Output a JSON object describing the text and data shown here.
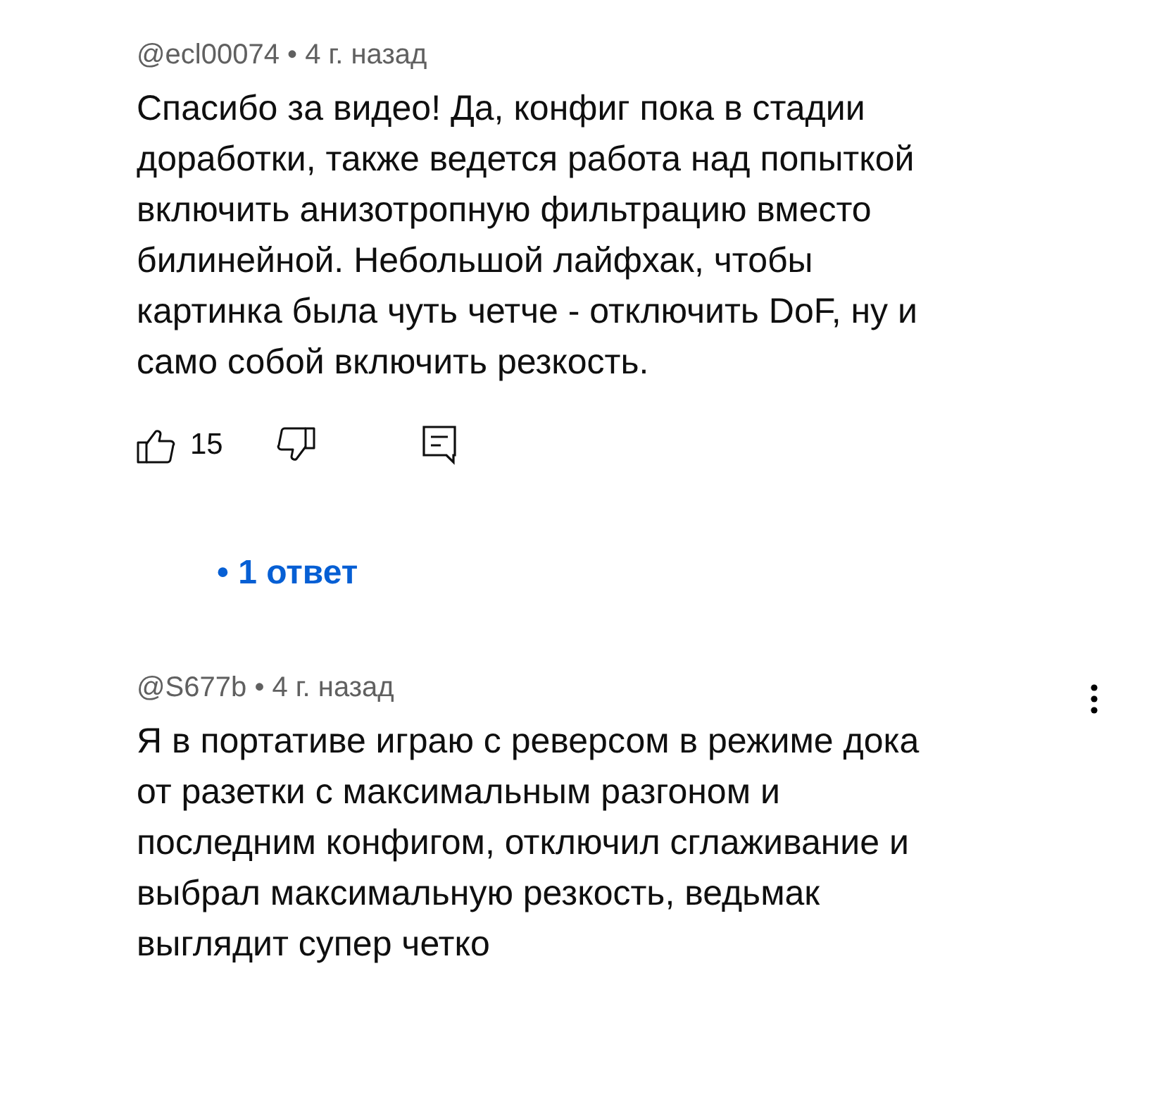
{
  "comments": [
    {
      "meta": "@ecl00074 • 4 г. назад",
      "menu": false,
      "text": "Спасибо за видео! Да, конфиг пока в стадии\nдоработки, также ведется работа над попыткой\nвключить анизотропную фильтрацию вместо\nбилинейной. Небольшой лайфхак, чтобы\nкартинка была чуть четче - отключить DoF, ну и\nсамо собой включить резкость.",
      "likes": "15",
      "replies": "• 1 ответ"
    },
    {
      "meta": "@S677b • 4 г. назад",
      "menu": true,
      "text": "Я в портативе играю с реверсом в режиме дока\nот разетки с максимальным разгоном и\nпоследним конфигом, отключил сглаживание и\nвыбрал максимальную резкость, ведьмак\nвыглядит супер четко"
    }
  ]
}
